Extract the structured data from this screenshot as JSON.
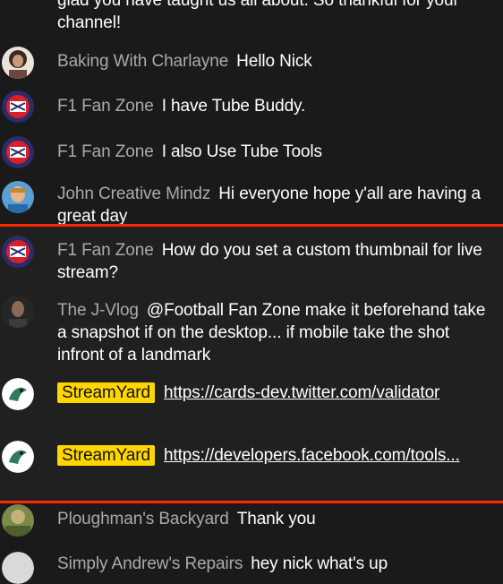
{
  "colors": {
    "background": "#1a1a1a",
    "author": "#aaaaaa",
    "badge": "#ffd600",
    "highlight_line": "#ff2a00"
  },
  "messages": [
    {
      "author": "",
      "text": "glad you have taught us all about. So thankful for your channel!",
      "avatar": "partial"
    },
    {
      "author": "Baking With Charlayne",
      "text": "Hello Nick",
      "avatar": "woman-photo-icon"
    },
    {
      "author": "F1 Fan Zone",
      "text": "I have Tube Buddy.",
      "avatar": "f1-logo-icon"
    },
    {
      "author": "F1 Fan Zone",
      "text": "I also Use Tube Tools",
      "avatar": "f1-logo-icon"
    },
    {
      "author": "John Creative Mindz",
      "text": "Hi everyone hope y'all are having a great day",
      "avatar": "man-photo-icon"
    },
    {
      "author": "F1 Fan Zone",
      "text": "How do you set a custom thumbnail for live stream?",
      "avatar": "f1-logo-icon"
    },
    {
      "author": "The J-Vlog",
      "text": "@Football Fan Zone make it beforehand take a snapshot if on the desktop... if mobile take the shot infront of a landmark",
      "avatar": "man-dark-photo-icon"
    },
    {
      "author": "StreamYard",
      "text": "https://cards-dev.twitter.com/validator",
      "avatar": "streamyard-logo-icon",
      "badge": true
    },
    {
      "author": "StreamYard",
      "text": "https://developers.facebook.com/tools...",
      "avatar": "streamyard-logo-icon",
      "badge": true
    },
    {
      "author": "Ploughman's Backyard",
      "text": "Thank you",
      "avatar": "outdoor-photo-icon"
    },
    {
      "author": "Simply Andrew's Repairs",
      "text": "hey nick what's up",
      "avatar": "partial"
    }
  ]
}
